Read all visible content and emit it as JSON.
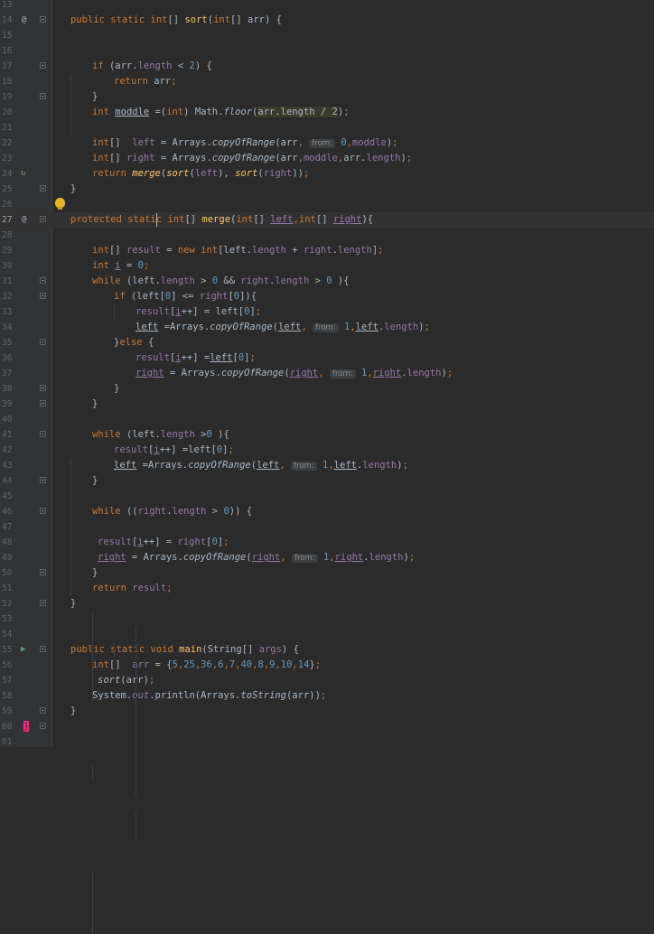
{
  "gutter_icons": {
    "at": "@",
    "recursive": "↻",
    "run": "▶"
  },
  "lines": [
    {
      "n": "13",
      "text": ""
    },
    {
      "n": "14",
      "text": "public static int[] sort(int[] arr) {"
    },
    {
      "n": "15",
      "text": ""
    },
    {
      "n": "16",
      "text": ""
    },
    {
      "n": "17",
      "text": "if (arr.length < 2) {"
    },
    {
      "n": "18",
      "text": "return arr;"
    },
    {
      "n": "19",
      "text": "}"
    },
    {
      "n": "20",
      "text": "int moddle =(int) Math.floor(arr.length / 2);"
    },
    {
      "n": "21",
      "text": ""
    },
    {
      "n": "22",
      "text": "int[]  left = Arrays.copyOfRange(arr, from: 0,moddle);"
    },
    {
      "n": "23",
      "text": "int[] right = Arrays.copyOfRange(arr,moddle,arr.length);"
    },
    {
      "n": "24",
      "text": "return merge(sort(left), sort(right));"
    },
    {
      "n": "25",
      "text": "}"
    },
    {
      "n": "26",
      "text": ""
    },
    {
      "n": "27",
      "text": "protected static int[] merge(int[] left,int[] right){"
    },
    {
      "n": "28",
      "text": ""
    },
    {
      "n": "29",
      "text": "int[] result = new int[left.length + right.length];"
    },
    {
      "n": "30",
      "text": "int i = 0;"
    },
    {
      "n": "31",
      "text": "while (left.length > 0 && right.length > 0 ){"
    },
    {
      "n": "32",
      "text": "if (left[0] <= right[0]){"
    },
    {
      "n": "33",
      "text": "result[i++] = left[0];"
    },
    {
      "n": "34",
      "text": "left =Arrays.copyOfRange(left, from: 1,left.length);"
    },
    {
      "n": "35",
      "text": "}else {"
    },
    {
      "n": "36",
      "text": "result[i++] =left[0];"
    },
    {
      "n": "37",
      "text": "right = Arrays.copyOfRange(right, from: 1,right.length);"
    },
    {
      "n": "38",
      "text": "}"
    },
    {
      "n": "39",
      "text": "}"
    },
    {
      "n": "40",
      "text": ""
    },
    {
      "n": "41",
      "text": "while (left.length >0 ){"
    },
    {
      "n": "42",
      "text": "result[i++] =left[0];"
    },
    {
      "n": "43",
      "text": "left =Arrays.copyOfRange(left, from: 1,left.length);"
    },
    {
      "n": "44",
      "text": "}"
    },
    {
      "n": "45",
      "text": ""
    },
    {
      "n": "46",
      "text": "while ((right.length > 0)) {"
    },
    {
      "n": "47",
      "text": ""
    },
    {
      "n": "48",
      "text": "result[i++] = right[0];"
    },
    {
      "n": "49",
      "text": "right = Arrays.copyOfRange(right, from: 1,right.length);"
    },
    {
      "n": "50",
      "text": "}"
    },
    {
      "n": "51",
      "text": "return result;"
    },
    {
      "n": "52",
      "text": "}"
    },
    {
      "n": "53",
      "text": ""
    },
    {
      "n": "54",
      "text": ""
    },
    {
      "n": "55",
      "text": "public static void main(String[] args) {"
    },
    {
      "n": "56",
      "text": "int[]  arr = {5,25,36,6,7,40,8,9,10,14};"
    },
    {
      "n": "57",
      "text": "sort(arr);"
    },
    {
      "n": "58",
      "text": "System.out.println(Arrays.toString(arr));"
    },
    {
      "n": "59",
      "text": "}"
    },
    {
      "n": "60",
      "text": "}"
    },
    {
      "n": "61",
      "text": ""
    }
  ],
  "colors": {
    "background": "#2b2b2b",
    "gutter": "#313335",
    "keyword": "#cc7832",
    "number": "#6897bb",
    "field": "#9876aa",
    "method": "#ffc66d",
    "text": "#a9b7c6"
  }
}
